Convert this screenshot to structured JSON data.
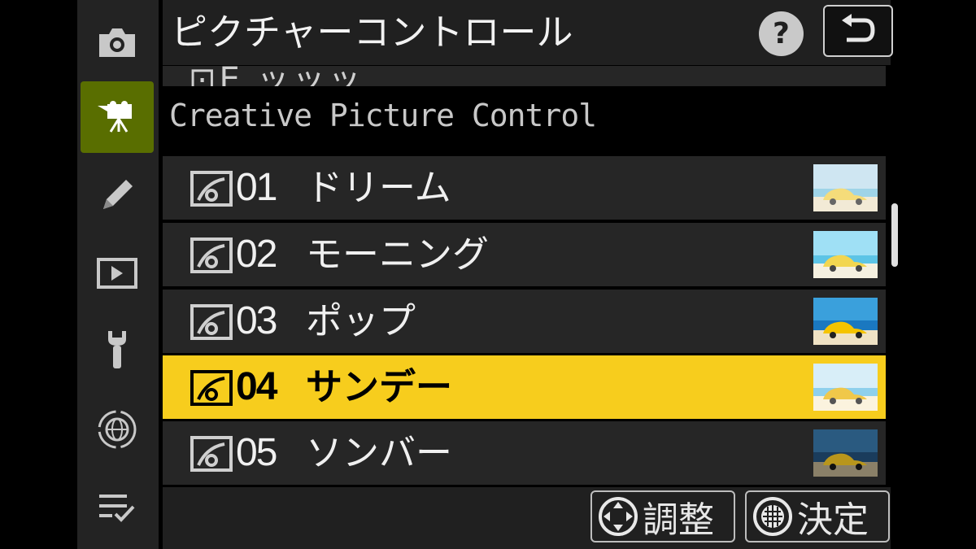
{
  "header": {
    "title": "ピクチャーコントロール",
    "help_label": "?"
  },
  "list": {
    "cut_row_text": "⊡E ッッッ",
    "section_header": "Creative Picture Control",
    "items": [
      {
        "num": "01",
        "name": "ドリーム",
        "selected": false
      },
      {
        "num": "02",
        "name": "モーニング",
        "selected": false
      },
      {
        "num": "03",
        "name": "ポップ",
        "selected": false
      },
      {
        "num": "04",
        "name": "サンデー",
        "selected": true
      },
      {
        "num": "05",
        "name": "ソンバー",
        "selected": false
      }
    ]
  },
  "footer": {
    "adjust_label": "調整",
    "ok_label": "決定"
  },
  "sidebar": {
    "items": [
      {
        "icon": "camera-icon",
        "active": false
      },
      {
        "icon": "movie-camera-icon",
        "active": true
      },
      {
        "icon": "pencil-icon",
        "active": false
      },
      {
        "icon": "playback-icon",
        "active": false
      },
      {
        "icon": "wrench-icon",
        "active": false
      },
      {
        "icon": "network-icon",
        "active": false
      },
      {
        "icon": "my-menu-icon",
        "active": false
      }
    ]
  },
  "colors": {
    "selected": "#f7cd1d",
    "active_tab": "#596e00",
    "row": "#262626"
  }
}
